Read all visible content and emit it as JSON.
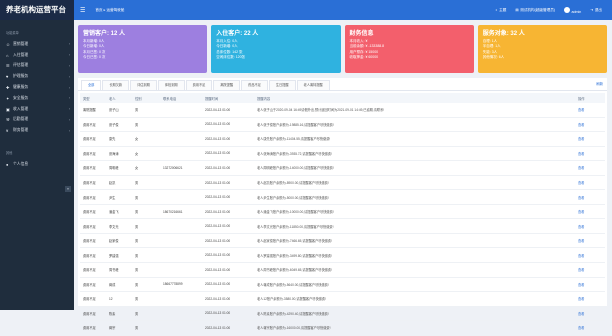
{
  "app": {
    "title": "养老机构运营平台"
  },
  "topbar": {
    "menu_icon": "menu-icon",
    "center_text": "首页  ▸ 运营驾驶舱",
    "items": [
      {
        "label": "主题",
        "icon": "palette-icon"
      },
      {
        "label": "测试机构(超级管理员)",
        "icon": "building-icon"
      },
      {
        "label": "admin",
        "icon": "user-icon"
      },
      {
        "label": "退出",
        "icon": "logout-icon"
      }
    ]
  },
  "sidebar": {
    "section1": "功能菜单",
    "items": [
      {
        "label": "营销管理",
        "icon": "person-icon"
      },
      {
        "label": "入住管理",
        "icon": "home-icon"
      },
      {
        "label": "评估管理",
        "icon": "clipboard-icon"
      },
      {
        "label": "护理服务",
        "icon": "heart-icon"
      },
      {
        "label": "健康服务",
        "icon": "medkit-icon"
      },
      {
        "label": "安全服务",
        "icon": "shield-icon"
      },
      {
        "label": "收入管理",
        "icon": "wallet-icon"
      },
      {
        "label": "后勤管理",
        "icon": "tools-icon"
      },
      {
        "label": "财务管理",
        "icon": "money-icon"
      }
    ],
    "section2": "其他",
    "personal": {
      "label": "个人信息",
      "icon": "person-icon"
    }
  },
  "cards": [
    {
      "title": "营销客户: 12 人",
      "color": "#9d7fe0",
      "lines": [
        "本月新增: 0人",
        "今日新增: 0人",
        "本月已签: 0 次",
        "今日已签: 0 次"
      ]
    },
    {
      "title": "入住客户: 22 人",
      "color": "#2fb2e0",
      "lines": [
        "本月入住: 0人",
        "今日新增: 0人",
        "总床位数: 142 张",
        "空闲床位数: 120张"
      ]
    },
    {
      "title": "财务信息",
      "color": "#f35f6c",
      "lines": [
        "本月收入: ¥",
        "当前余额: ¥ -133388.8",
        "用户预存: ¥ 15000",
        "收取押金: ¥ 60000"
      ]
    },
    {
      "title": "服务对象: 32 人",
      "color": "#f7b533",
      "lines": [
        "自理: 1人",
        "半自理: 1人",
        "失能: 3人",
        "其他情况: 6人"
      ]
    }
  ],
  "tabs": [
    "全部",
    "长期欠款",
    "评估到期",
    "体检到期",
    "费用不足",
    "离院提醒",
    "药品不足",
    "生日提醒",
    "老人离特提醒"
  ],
  "refresh": "刷新",
  "table": {
    "headers": [
      "类型",
      "老人",
      "性别",
      "联系电话",
      "提醒时间",
      "提醒内容",
      "操作"
    ],
    "rows": [
      [
        "离院提醒",
        "张子山",
        "男",
        "",
        "2022-04-13 01:00",
        "老人张子山于2020-09-04 16:49请假外出,预计返回时间为2021-09-01 14:49,已逾期,请联系!",
        "查看"
      ],
      [
        "费用不足",
        "张子俊",
        "男",
        "",
        "2022-04-13 01:00",
        "老人张子俊账户余额为-19885.16,请提醒客户尽快缴费!",
        "查看"
      ],
      [
        "费用不足",
        "康先",
        "女",
        "",
        "2022-04-13 01:00",
        "老人康先账户余额为-11404.55,请提醒客户尽快缴费!",
        "查看"
      ],
      [
        "费用不足",
        "张海涛",
        "女",
        "",
        "2022-04-13 01:00",
        "老人张海涛账户余额为-3935.72,请提醒客户尽快缴费!",
        "查看"
      ],
      [
        "费用不足",
        "周明峰",
        "女",
        "13272006621",
        "2022-04-13 01:00",
        "老人周明峰账户余额为-14000.00,请提醒客户尽快缴费!",
        "查看"
      ],
      [
        "费用不足",
        "赵凯",
        "男",
        "",
        "2022-04-13 01:00",
        "老人赵凯账户余额为-8900.00,请提醒客户尽快缴费!",
        "查看"
      ],
      [
        "费用不足",
        "尹生",
        "男",
        "",
        "2022-04-13 01:00",
        "老人尹生账户余额为-5000.00,请提醒客户尽快缴费!",
        "查看"
      ],
      [
        "费用不足",
        "潘金飞",
        "男",
        "18670216661",
        "2022-04-13 01:00",
        "老人潘金飞账户余额为-10000.00,请提醒客户尽快缴费!",
        "查看"
      ],
      [
        "费用不足",
        "李文光",
        "男",
        "",
        "2022-04-13 01:00",
        "老人李文光账户余额为-11850.00,请提醒客户尽快缴费!",
        "查看"
      ],
      [
        "费用不足",
        "赵家俊",
        "男",
        "",
        "2022-04-13 01:00",
        "老人赵家俊账户余额为-7466.65,请提醒客户尽快缴费!",
        "查看"
      ],
      [
        "费用不足",
        "罗建强",
        "男",
        "",
        "2022-04-13 01:00",
        "老人罗建强账户余额为-3499.80,请提醒客户尽快缴费!",
        "查看"
      ],
      [
        "费用不足",
        "周书峰",
        "男",
        "",
        "2022-04-13 01:00",
        "老人周书峰账户余额为-6049.65,请提醒客户尽快缴费!",
        "查看"
      ],
      [
        "费用不足",
        "蒋成",
        "男",
        "18667778899",
        "2022-04-13 01:00",
        "老人蒋成账户余额为-5640.00,请提醒客户尽快缴费!",
        "查看"
      ],
      [
        "费用不足",
        "12",
        "男",
        "",
        "2022-04-13 01:00",
        "老人12账户余额为-3580.00,请提醒客户尽快缴费!",
        "查看"
      ],
      [
        "费用不足",
        "陈素",
        "男",
        "",
        "2022-04-13 01:00",
        "老人陈素账户余额为-4290.40,请提醒客户尽快缴费!",
        "查看"
      ],
      [
        "费用不足",
        "蒋宗",
        "男",
        "",
        "2022-04-13 01:00",
        "老人蒋宗账户余额为-16000.00,请提醒客户尽快缴费!",
        "查看"
      ]
    ]
  }
}
